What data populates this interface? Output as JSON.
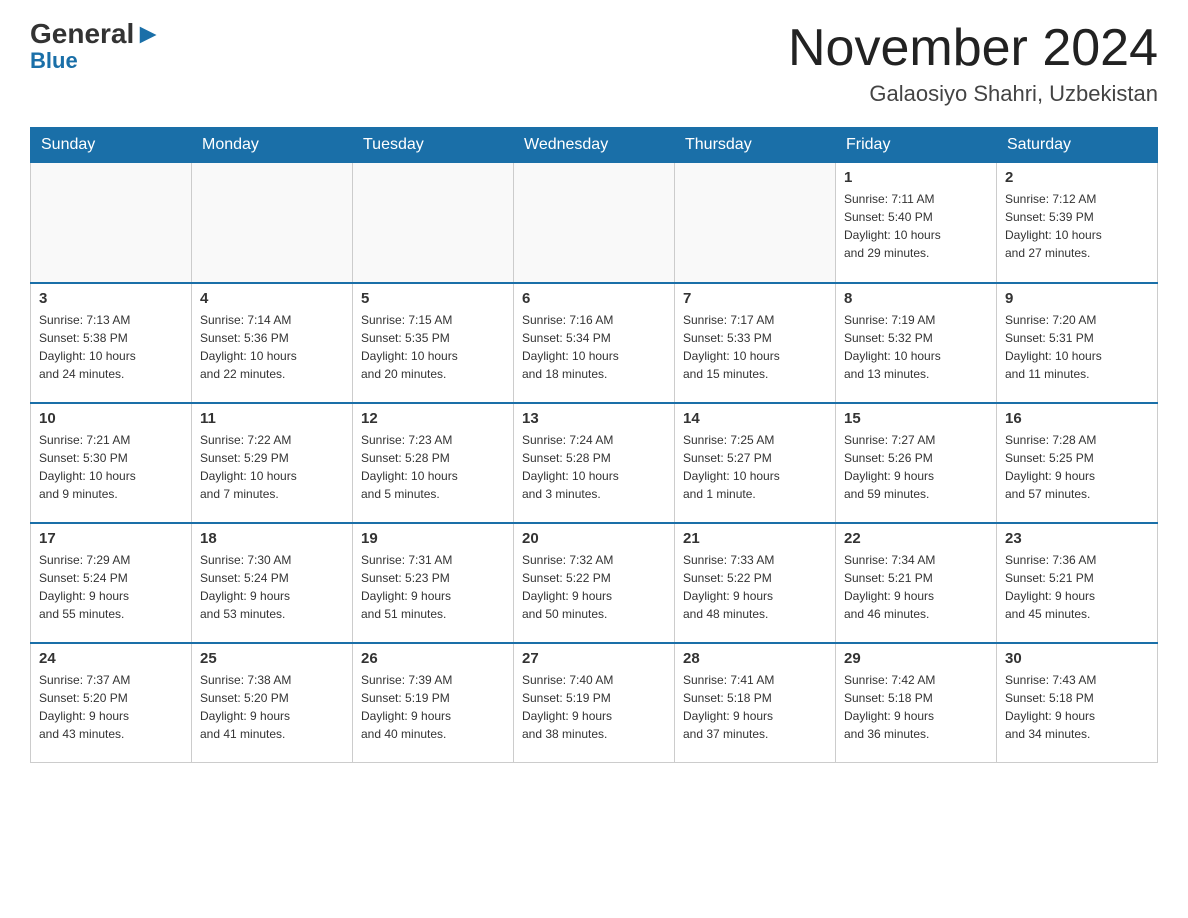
{
  "logo": {
    "general": "General",
    "blue_highlight": "▶",
    "blue": "Blue"
  },
  "title": {
    "month_year": "November 2024",
    "location": "Galaosiyo Shahri, Uzbekistan"
  },
  "headers": [
    "Sunday",
    "Monday",
    "Tuesday",
    "Wednesday",
    "Thursday",
    "Friday",
    "Saturday"
  ],
  "weeks": [
    [
      {
        "day": "",
        "info": ""
      },
      {
        "day": "",
        "info": ""
      },
      {
        "day": "",
        "info": ""
      },
      {
        "day": "",
        "info": ""
      },
      {
        "day": "",
        "info": ""
      },
      {
        "day": "1",
        "info": "Sunrise: 7:11 AM\nSunset: 5:40 PM\nDaylight: 10 hours\nand 29 minutes."
      },
      {
        "day": "2",
        "info": "Sunrise: 7:12 AM\nSunset: 5:39 PM\nDaylight: 10 hours\nand 27 minutes."
      }
    ],
    [
      {
        "day": "3",
        "info": "Sunrise: 7:13 AM\nSunset: 5:38 PM\nDaylight: 10 hours\nand 24 minutes."
      },
      {
        "day": "4",
        "info": "Sunrise: 7:14 AM\nSunset: 5:36 PM\nDaylight: 10 hours\nand 22 minutes."
      },
      {
        "day": "5",
        "info": "Sunrise: 7:15 AM\nSunset: 5:35 PM\nDaylight: 10 hours\nand 20 minutes."
      },
      {
        "day": "6",
        "info": "Sunrise: 7:16 AM\nSunset: 5:34 PM\nDaylight: 10 hours\nand 18 minutes."
      },
      {
        "day": "7",
        "info": "Sunrise: 7:17 AM\nSunset: 5:33 PM\nDaylight: 10 hours\nand 15 minutes."
      },
      {
        "day": "8",
        "info": "Sunrise: 7:19 AM\nSunset: 5:32 PM\nDaylight: 10 hours\nand 13 minutes."
      },
      {
        "day": "9",
        "info": "Sunrise: 7:20 AM\nSunset: 5:31 PM\nDaylight: 10 hours\nand 11 minutes."
      }
    ],
    [
      {
        "day": "10",
        "info": "Sunrise: 7:21 AM\nSunset: 5:30 PM\nDaylight: 10 hours\nand 9 minutes."
      },
      {
        "day": "11",
        "info": "Sunrise: 7:22 AM\nSunset: 5:29 PM\nDaylight: 10 hours\nand 7 minutes."
      },
      {
        "day": "12",
        "info": "Sunrise: 7:23 AM\nSunset: 5:28 PM\nDaylight: 10 hours\nand 5 minutes."
      },
      {
        "day": "13",
        "info": "Sunrise: 7:24 AM\nSunset: 5:28 PM\nDaylight: 10 hours\nand 3 minutes."
      },
      {
        "day": "14",
        "info": "Sunrise: 7:25 AM\nSunset: 5:27 PM\nDaylight: 10 hours\nand 1 minute."
      },
      {
        "day": "15",
        "info": "Sunrise: 7:27 AM\nSunset: 5:26 PM\nDaylight: 9 hours\nand 59 minutes."
      },
      {
        "day": "16",
        "info": "Sunrise: 7:28 AM\nSunset: 5:25 PM\nDaylight: 9 hours\nand 57 minutes."
      }
    ],
    [
      {
        "day": "17",
        "info": "Sunrise: 7:29 AM\nSunset: 5:24 PM\nDaylight: 9 hours\nand 55 minutes."
      },
      {
        "day": "18",
        "info": "Sunrise: 7:30 AM\nSunset: 5:24 PM\nDaylight: 9 hours\nand 53 minutes."
      },
      {
        "day": "19",
        "info": "Sunrise: 7:31 AM\nSunset: 5:23 PM\nDaylight: 9 hours\nand 51 minutes."
      },
      {
        "day": "20",
        "info": "Sunrise: 7:32 AM\nSunset: 5:22 PM\nDaylight: 9 hours\nand 50 minutes."
      },
      {
        "day": "21",
        "info": "Sunrise: 7:33 AM\nSunset: 5:22 PM\nDaylight: 9 hours\nand 48 minutes."
      },
      {
        "day": "22",
        "info": "Sunrise: 7:34 AM\nSunset: 5:21 PM\nDaylight: 9 hours\nand 46 minutes."
      },
      {
        "day": "23",
        "info": "Sunrise: 7:36 AM\nSunset: 5:21 PM\nDaylight: 9 hours\nand 45 minutes."
      }
    ],
    [
      {
        "day": "24",
        "info": "Sunrise: 7:37 AM\nSunset: 5:20 PM\nDaylight: 9 hours\nand 43 minutes."
      },
      {
        "day": "25",
        "info": "Sunrise: 7:38 AM\nSunset: 5:20 PM\nDaylight: 9 hours\nand 41 minutes."
      },
      {
        "day": "26",
        "info": "Sunrise: 7:39 AM\nSunset: 5:19 PM\nDaylight: 9 hours\nand 40 minutes."
      },
      {
        "day": "27",
        "info": "Sunrise: 7:40 AM\nSunset: 5:19 PM\nDaylight: 9 hours\nand 38 minutes."
      },
      {
        "day": "28",
        "info": "Sunrise: 7:41 AM\nSunset: 5:18 PM\nDaylight: 9 hours\nand 37 minutes."
      },
      {
        "day": "29",
        "info": "Sunrise: 7:42 AM\nSunset: 5:18 PM\nDaylight: 9 hours\nand 36 minutes."
      },
      {
        "day": "30",
        "info": "Sunrise: 7:43 AM\nSunset: 5:18 PM\nDaylight: 9 hours\nand 34 minutes."
      }
    ]
  ]
}
